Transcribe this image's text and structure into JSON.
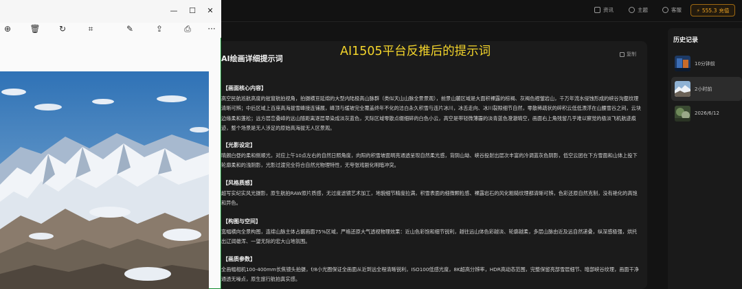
{
  "topbar": {
    "items": [
      {
        "icon": "data-icon",
        "label": "资讯"
      },
      {
        "icon": "theme-icon",
        "label": "主题"
      },
      {
        "icon": "headset-icon",
        "label": "客服"
      }
    ],
    "credit": {
      "icon": "lightning-icon",
      "value": "555.3",
      "action": "充值"
    }
  },
  "overlay_title": "AI1505平台反推后的提示词",
  "panel": {
    "title": "AI绘画详细提示词",
    "copy_label": "复制",
    "sections": [
      {
        "heading": "【画面核心内容】",
        "body": "高空民航巡航高度的舷窗航拍视角，拍摄横亘延绵的大型内陆极高山脉群（类似天山山脉全景景观），前景山麓区域是大面积裸露的棕褐、灰褐色褶皱岩山，千万年流水侵蚀形成的峡谷沟壑纹理清晰可辨；中后区域上百座高海拔雪峰接连铺展，峰顶与缓坡完全覆盖终年不化的洁白永久积雪与连片冰川，冰舌走向、冰川裂隙细节自然，零散稀疏状的碎积云低低漂浮在山腰雪谷之间，云块边缘柔和蓬松；远方层峦叠嶂的远山随距离逐层晕染成淡灰蓝色，天际区域零散点缀细碎的白色小云，高空是带轻微薄霾的淡青蓝色澄澈晴空，画面右上角残留几乎难以察觉的极淡飞机航迹痕迹，整个场景是无人涉足的原始高海拔无人区景观。"
      },
      {
        "heading": "【光影设定】",
        "body": "晴朗白昼的柔和侧顺光，对应上午10点左右的自然日照角度，向阳的积雪坡面明亮通透呈现自然柔光感，背阴山坳、峡谷投射出层次丰富的冷调蓝灰色阴影，低空云团在下方雪面和山体上投下轮廓柔和的浅阴影，光影过渡完全符合自然光物理特性，无夸张戏剧化明暗冲突。"
      },
      {
        "heading": "【风格质感】",
        "body": "超写实纪实风光摄影，原生航拍RAW原片质感，无过度滤镜艺术加工，地貌细节精度拉满，积雪表面的细微颗粒感、裸露岩石的风化粗糙纹理都清晰可辨，色彩还原自然克制，没有艳化的高饱和异色。"
      },
      {
        "heading": "【构图与空间】",
        "body": "宽幅横向全景构图，连绵山脉主体占据画面75%区域，严格还原大气透视物理效果：近山色彩饱和细节锐利，越往远山体色彩越淡、轮廓越柔，多层山脉由近及远自然递叠，纵深感极强，烘托出辽阔雄浑、一望无际的宏大山地氛围。"
      },
      {
        "heading": "【画质参数】",
        "body": "全画幅相机100-400mm长焦镜头拍摄，f/8小光圈保证全画面从近到远全程清晰锐利，ISO100低感光度，8K超高分辨率，HDR高动态范围，完整保留亮部雪层细节、暗部峡谷纹理，画面干净通透无噪点，原生旅行航拍真实感。"
      }
    ]
  },
  "history": {
    "title": "历史记录",
    "items": [
      {
        "label": "10分钟前",
        "active": false
      },
      {
        "label": "2小时前",
        "active": true
      },
      {
        "label": "2026/6/12",
        "active": false
      }
    ]
  },
  "viewer": {
    "window_controls": [
      "—",
      "☐",
      "✕"
    ],
    "tools": [
      {
        "name": "zoom-in-icon",
        "glyph": "⊕"
      },
      {
        "name": "delete-icon",
        "glyph": "🗑"
      },
      {
        "name": "rotate-icon",
        "glyph": "↻"
      },
      {
        "name": "crop-icon",
        "glyph": "⌗"
      },
      {
        "name": "edit-icon",
        "glyph": "✎"
      },
      {
        "name": "share-icon",
        "glyph": "⇪"
      },
      {
        "name": "print-icon",
        "glyph": "⎙"
      },
      {
        "name": "more-icon",
        "glyph": "···"
      }
    ]
  },
  "colors": {
    "accent": "#f2a623",
    "overlay_text": "#f4d52b",
    "panel_bg": "#1b1b1b",
    "page_bg": "#131313"
  }
}
